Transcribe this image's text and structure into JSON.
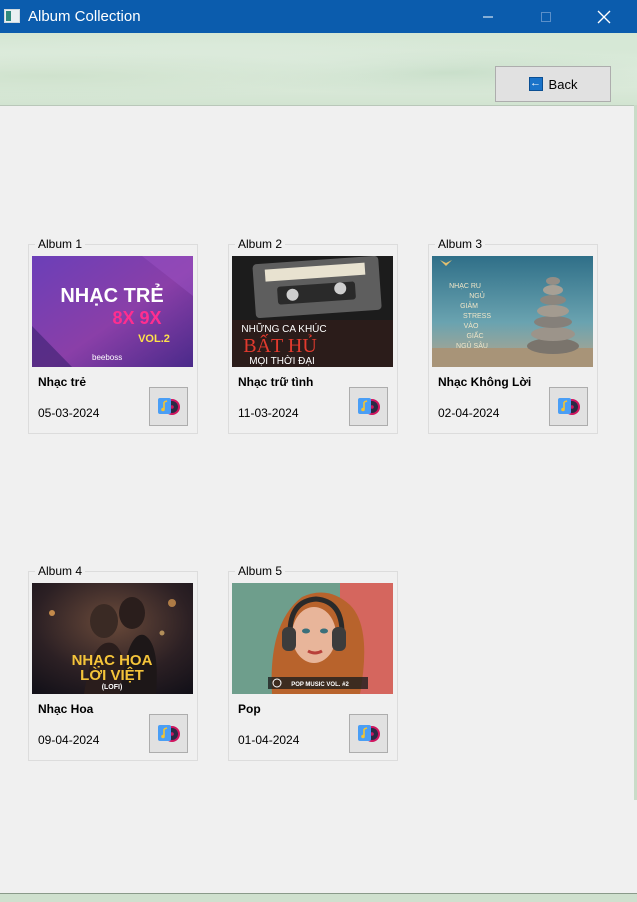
{
  "window": {
    "title": "Album Collection"
  },
  "header": {
    "back_label": "Back"
  },
  "albums": [
    {
      "caption": "Album 1",
      "name": "Nhạc trẻ",
      "date": "05-03-2024",
      "cover": {
        "line1": "NHẠC TRẺ",
        "line2": "8X 9X",
        "line3": "VOL.2",
        "brand": "beeboss"
      }
    },
    {
      "caption": "Album 2",
      "name": "Nhạc trữ tình",
      "date": "11-03-2024",
      "cover": {
        "line1": "NHỮNG CA KHÚC",
        "line2": "BẤT HỦ",
        "line3": "MỌI THỜI ĐẠI"
      }
    },
    {
      "caption": "Album 3",
      "name": "Nhạc Không Lời",
      "date": "02-04-2024",
      "cover": {
        "words": [
          "NHẠC RU",
          "NGỦ",
          "GIẢM",
          "STRESS",
          "VÀO",
          "GIẤC",
          "NGỦ SÂU"
        ]
      }
    },
    {
      "caption": "Album 4",
      "name": "Nhạc Hoa",
      "date": "09-04-2024",
      "cover": {
        "line1": "NHẠC HOA",
        "line2": "LỜI VIỆT",
        "line3": "(LOFI)"
      }
    },
    {
      "caption": "Album 5",
      "name": "Pop",
      "date": "01-04-2024",
      "cover": {
        "line1": "POP MUSIC VOL. #2"
      }
    }
  ]
}
